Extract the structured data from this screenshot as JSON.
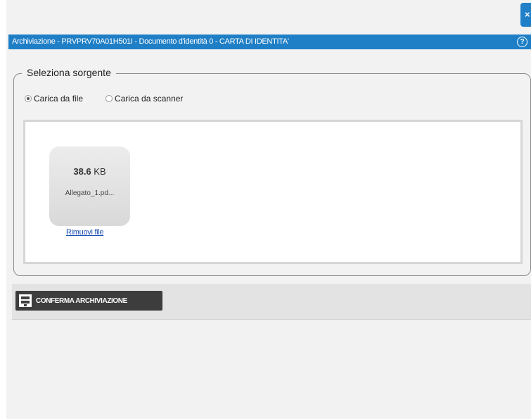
{
  "window": {
    "close_glyph": "×",
    "title": "Archiviazione - PRVPRV70A01H501I - Documento d'identità 0 - CARTA DI IDENTITA'",
    "help_glyph": "?",
    "accent_color": "#1f7fc6"
  },
  "source": {
    "legend": "Seleziona sorgente",
    "options": [
      {
        "label": "Carica da file",
        "checked": true
      },
      {
        "label": "Carica da scanner",
        "checked": false
      }
    ]
  },
  "file": {
    "size_value": "38.6",
    "size_unit": "KB",
    "name": "Allegato_1.pd...",
    "remove_label": "Rimuovi file"
  },
  "actions": {
    "confirm_label": "CONFERMA ARCHIVIAZIONE",
    "confirm_icon": "archive-icon"
  }
}
